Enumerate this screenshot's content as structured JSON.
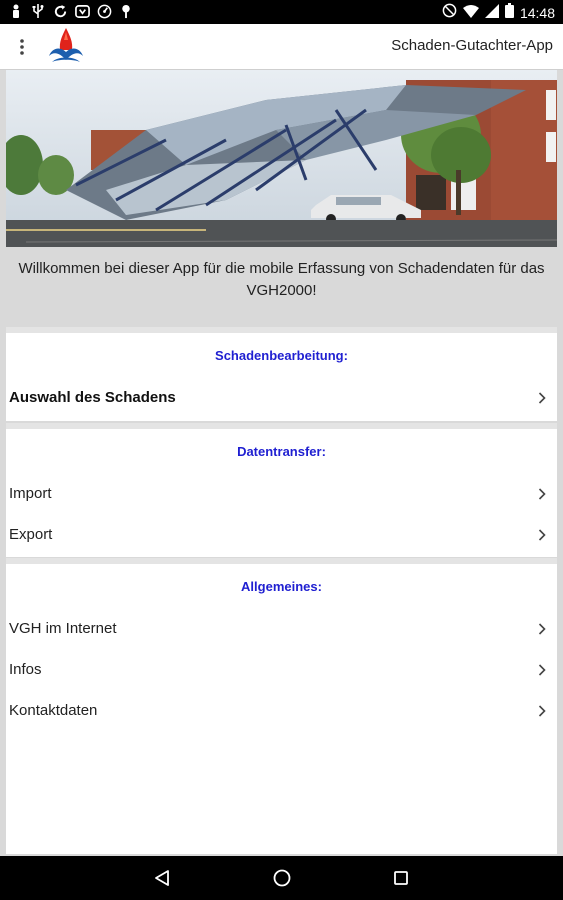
{
  "status_bar": {
    "time": "14:48",
    "left_icons": [
      "person-icon",
      "usb-icon",
      "sync-icon",
      "shield-icon",
      "speed-icon",
      "location-pin-icon"
    ],
    "right_icons": [
      "do-not-disturb-icon",
      "wifi-icon",
      "signal-icon",
      "battery-icon"
    ]
  },
  "app_bar": {
    "title": "Schaden-Gutachter-App",
    "menu_icon": "more-vert-icon",
    "logo": "vgh-logo"
  },
  "welcome_text": "Willkommen bei dieser App für die mobile Erfassung von Schadendaten für das VGH2000!",
  "sections": [
    {
      "heading": "Schadenbearbeitung:",
      "items": [
        {
          "label": "Auswahl des Schadens"
        }
      ]
    },
    {
      "heading": "Datentransfer:",
      "items": [
        {
          "label": "Import"
        },
        {
          "label": "Export"
        }
      ]
    },
    {
      "heading": "Allgemeines:",
      "items": [
        {
          "label": "VGH im Internet"
        },
        {
          "label": "Infos"
        },
        {
          "label": "Kontaktdaten"
        }
      ]
    }
  ],
  "nav_bar": {
    "back": "back-icon",
    "home": "home-icon",
    "recents": "recents-icon"
  },
  "colors": {
    "section_heading": "#1f1fd1",
    "background": "#d9d9d9"
  }
}
